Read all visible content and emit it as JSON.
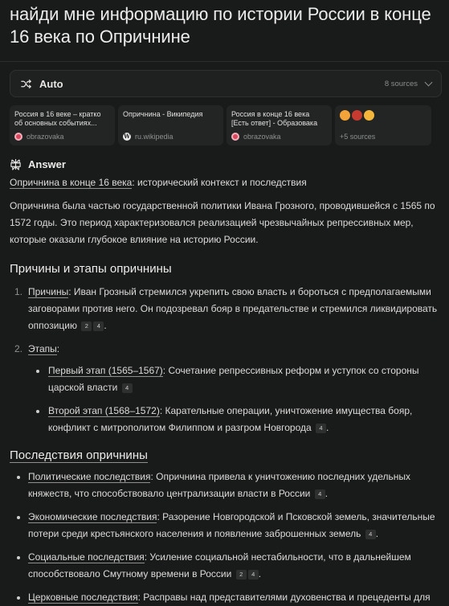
{
  "question": "найди мне информацию по истории России в конце 16 века по Опричнине",
  "mode": {
    "label": "Auto",
    "sources_label": "8 sources"
  },
  "sources": [
    {
      "title": "Россия в 16 веке – кратко об основных событиях...",
      "domain": "obrazovaka"
    },
    {
      "title": "Опричнина - Википедия",
      "domain": "ru.wikipedia"
    },
    {
      "title": "Россия в конце 16 века [Есть ответ] - Образовака",
      "domain": "obrazovaka"
    }
  ],
  "more_sources": "+5 sources",
  "answer_label": "Answer",
  "heading_main": {
    "bold": "Опричнина в конце 16 века",
    "rest": ": исторический контекст и последствия"
  },
  "intro": "Опричнина была частью государственной политики Ивана Грозного, проводившейся с 1565 по 1572 годы. Это период характеризовался реализацией чрезвычайных репрессивных мер, которые оказали глубокое влияние на историю России.",
  "section1": {
    "title": "Причины и этапы опричнины",
    "items": [
      {
        "num": "1.",
        "label": "Причины",
        "text": ": Иван Грозный стремился укрепить свою власть и бороться с предполагаемыми заговорами против него. Он подозревал бояр в предательстве и стремился ликвидировать оппозицию",
        "cites": [
          "2",
          "4"
        ]
      },
      {
        "num": "2.",
        "label": "Этапы",
        "text": ":"
      }
    ],
    "stages": [
      {
        "label": "Первый этап (1565–1567)",
        "text": ": Сочетание репрессивных реформ и уступок со стороны царской власти",
        "cites": [
          "4"
        ]
      },
      {
        "label": "Второй этап (1568–1572)",
        "text": ": Карательные операции, уничтожение имущества бояр, конфликт с митрополитом Филиппом и разгром Новгорода",
        "cites": [
          "4"
        ]
      }
    ]
  },
  "section2": {
    "title": "Последствия опричнины",
    "items": [
      {
        "label": "Политические последствия",
        "text": ": Опричнина привела к уничтожению последних удельных княжеств, что способствовало централизации власти в России",
        "cites": [
          "4"
        ]
      },
      {
        "label": "Экономические последствия",
        "text": ": Разорение Новгородской и Псковской земель, значительные потери среди крестьянского населения и появление заброшенных земель",
        "cites": [
          "4"
        ]
      },
      {
        "label": "Социальные последствия",
        "text": ": Усиление социальной нестабильности, что в дальнейшем способствовало Смутному времени в России",
        "cites": [
          "2",
          "4"
        ]
      },
      {
        "label": "Церковные последствия",
        "text": ": Расправы над представителями духовенства и прецеденты для",
        "cites": []
      }
    ]
  },
  "colors": {
    "background": "#191a1a",
    "card": "#232525",
    "text": "#e8e8e6",
    "muted": "#8d9090"
  }
}
